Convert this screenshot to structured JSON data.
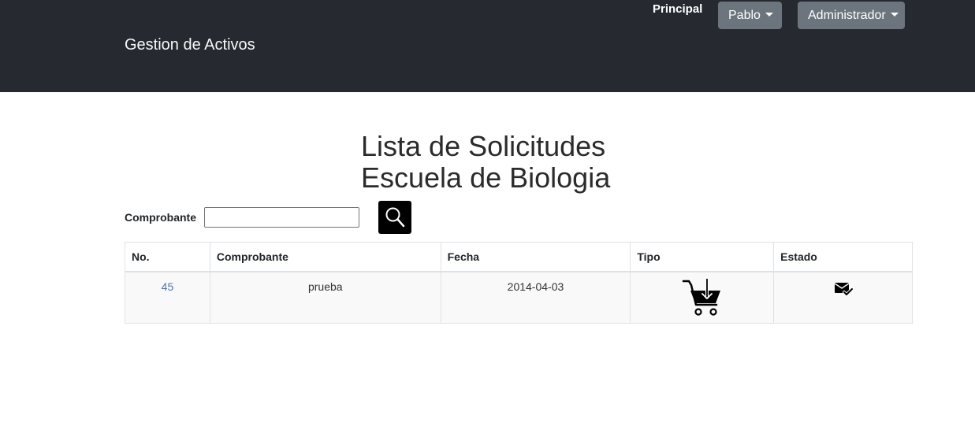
{
  "header": {
    "brand": "Gestion de Activos",
    "nav_principal": "Principal",
    "user_menu": "Pablo",
    "role_menu": "Administrador"
  },
  "page": {
    "title_line1": "Lista de Solicitudes",
    "title_line2": "Escuela de Biologia"
  },
  "search": {
    "label": "Comprobante",
    "value": "",
    "placeholder": ""
  },
  "table": {
    "headers": [
      "No.",
      "Comprobante",
      "Fecha",
      "Tipo",
      "Estado"
    ],
    "rows": [
      {
        "no": "45",
        "comprobante": "prueba",
        "fecha": "2014-04-03",
        "tipo_icon": "cart-download-icon",
        "estado_icon": "mail-check-icon"
      }
    ]
  },
  "colors": {
    "navbar": "#262930",
    "dropdown": "#6c757d",
    "link": "#4a78b4"
  }
}
